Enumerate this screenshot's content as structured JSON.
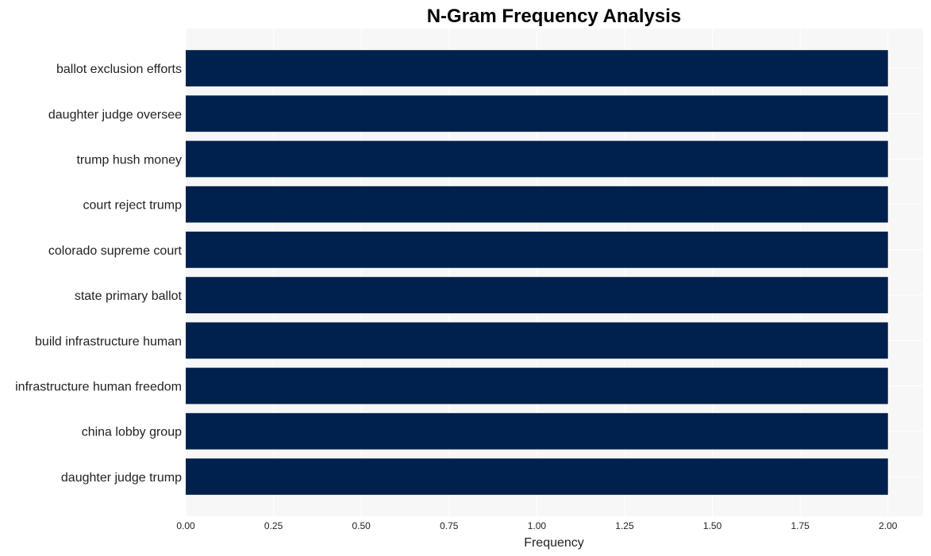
{
  "chart_data": {
    "type": "bar",
    "orientation": "horizontal",
    "title": "N-Gram Frequency Analysis",
    "xlabel": "Frequency",
    "ylabel": "",
    "xlim": [
      0,
      2.1
    ],
    "xticks": [
      0,
      0.25,
      0.5,
      0.75,
      1.0,
      1.25,
      1.5,
      1.75,
      2.0
    ],
    "xtick_labels": [
      "0.00",
      "0.25",
      "0.50",
      "0.75",
      "1.00",
      "1.25",
      "1.50",
      "1.75",
      "2.00"
    ],
    "grid": true,
    "categories": [
      "ballot exclusion efforts",
      "daughter judge oversee",
      "trump hush money",
      "court reject trump",
      "colorado supreme court",
      "state primary ballot",
      "build infrastructure human",
      "infrastructure human freedom",
      "china lobby group",
      "daughter judge trump"
    ],
    "values": [
      2,
      2,
      2,
      2,
      2,
      2,
      2,
      2,
      2,
      2
    ],
    "colors": {
      "bar": "#00214d",
      "plot_bg": "#f7f7f7",
      "grid": "#ffffff"
    }
  }
}
